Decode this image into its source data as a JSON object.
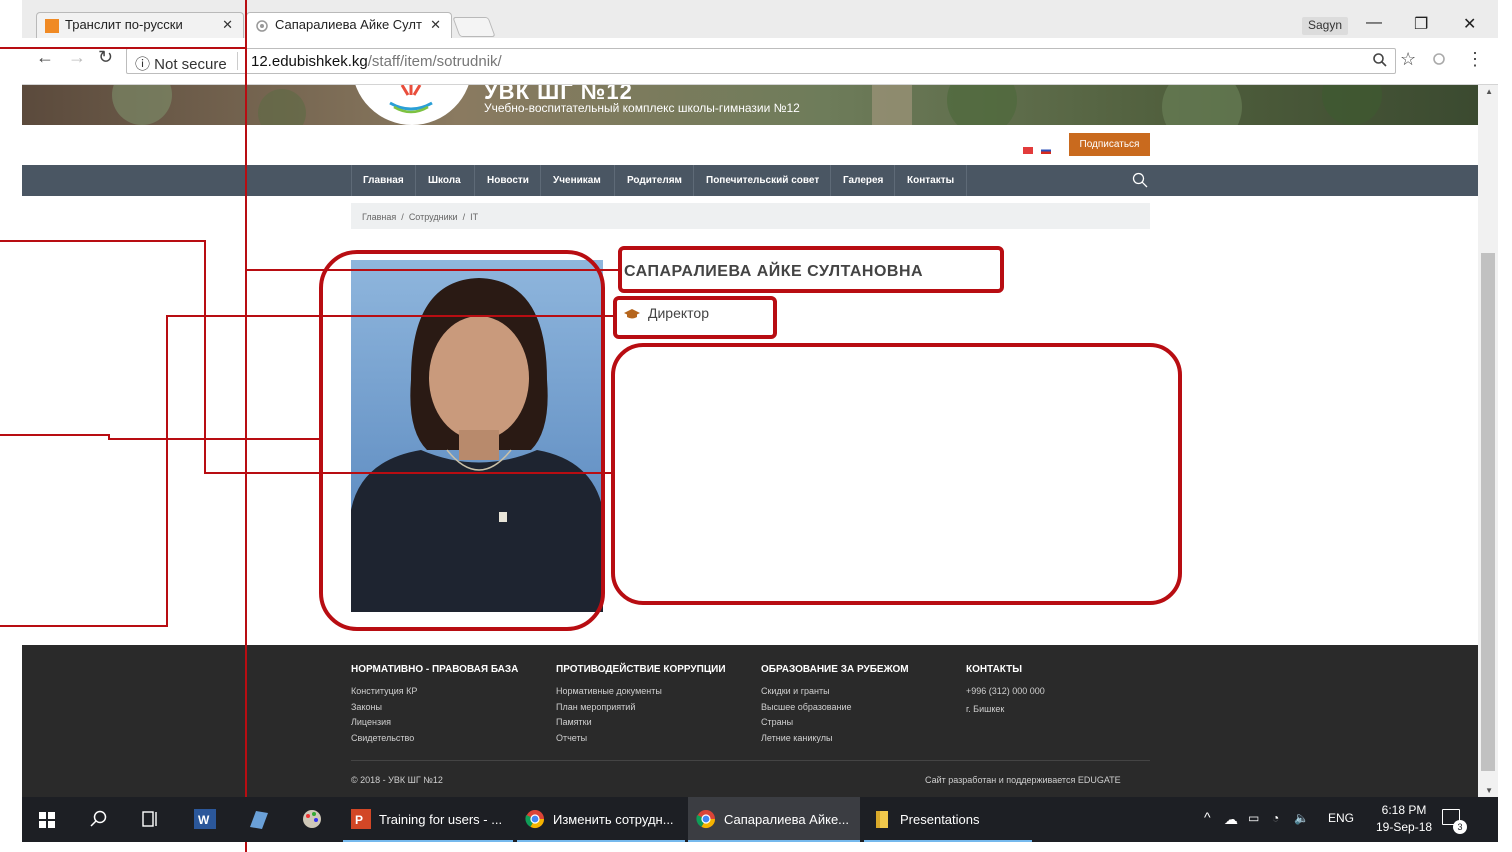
{
  "browser": {
    "tabs": [
      {
        "label": "Транслит по-русски"
      },
      {
        "label": "Сапаралиева Айке Султ"
      }
    ],
    "user_badge": "Sagyn",
    "security_label": "Not secure",
    "url_host": "12.edubishkek.kg",
    "url_path": "/staff/item/sotrudnik/"
  },
  "site": {
    "title": "УВК ШГ №12",
    "subtitle": "Учебно-воспитательный комплекс школы-гимназии №12",
    "subscribe_label": "Подписаться",
    "nav": [
      "Главная",
      "Школа",
      "Новости",
      "Ученикам",
      "Родителям",
      "Попечительский совет",
      "Галерея",
      "Контакты"
    ],
    "breadcrumb": [
      "Главная",
      "Сотрудники",
      "IT"
    ]
  },
  "staff": {
    "name": "САПАРАЛИЕВА АЙКЕ СУЛТАНОВНА",
    "position": "Директор"
  },
  "footer": {
    "columns": [
      {
        "heading": "НОРМАТИВНО - ПРАВОВАЯ БАЗА",
        "links": [
          "Конституция КР",
          "Законы",
          "Лицензия",
          "Свидетельство"
        ]
      },
      {
        "heading": "ПРОТИВОДЕЙСТВИЕ КОРРУПЦИИ",
        "links": [
          "Нормативные документы",
          "План мероприятий",
          "Памятки",
          "Отчеты"
        ]
      },
      {
        "heading": "ОБРАЗОВАНИЕ ЗА РУБЕЖОМ",
        "links": [
          "Скидки и гранты",
          "Высшее образование",
          "Страны",
          "Летние каникулы"
        ]
      },
      {
        "heading": "КОНТАКТЫ",
        "links": [
          "+996 (312) 000 000",
          "г. Бишкек"
        ]
      }
    ],
    "copyright": "© 2018 - УВК ШГ №12",
    "developer": "Сайт разработан и поддерживается EDUGATE"
  },
  "taskbar": {
    "apps": [
      {
        "label": "Training for users - ..."
      },
      {
        "label": "Изменить сотрудн..."
      },
      {
        "label": "Сапаралиева Айке..."
      },
      {
        "label": "Presentations"
      }
    ],
    "language": "ENG",
    "time": "6:18 PM",
    "date": "19-Sep-18",
    "notification_count": "3"
  },
  "colors": {
    "annotation": "#b80d12",
    "nav_bg": "#4a5663",
    "subscribe_bg": "#c96a1e",
    "footer_bg": "#2a2a2a"
  }
}
